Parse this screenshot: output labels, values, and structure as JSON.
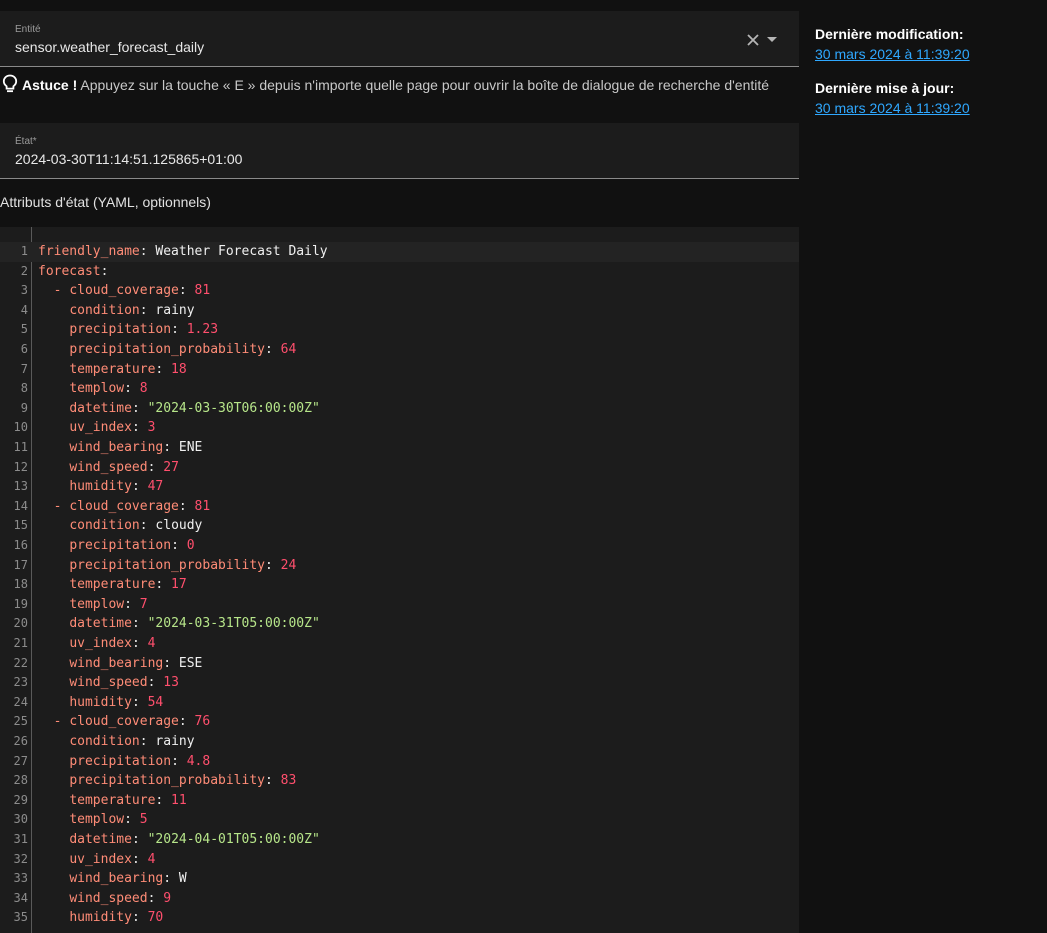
{
  "entity": {
    "label": "Entité",
    "value": "sensor.weather_forecast_daily"
  },
  "tip": {
    "bold": "Astuce !",
    "text": " Appuyez sur la touche « E » depuis n'importe quelle page pour ouvrir la boîte de dialogue de recherche d'entité"
  },
  "state": {
    "label": "État*",
    "value": "2024-03-30T11:14:51.125865+01:00"
  },
  "attributes_heading": "Attributs d'état (YAML, optionnels)",
  "sidebar": {
    "last_changed_label": "Dernière modification:",
    "last_changed_value": "30 mars 2024 à 11:39:20",
    "last_updated_label": "Dernière mise à jour:",
    "last_updated_value": "30 mars 2024 à 11:39:20"
  },
  "colors": {
    "key": "#ff8c77",
    "number": "#ff4f6d",
    "string": "#b7e68a",
    "link": "#2fa8ff"
  },
  "yaml_lines": [
    {
      "indent": "",
      "dash": false,
      "key": "friendly_name",
      "value": "Weather Forecast Daily",
      "type": "w"
    },
    {
      "indent": "",
      "dash": false,
      "key": "forecast",
      "value": "",
      "type": "w"
    },
    {
      "indent": "  ",
      "dash": true,
      "key": "cloud_coverage",
      "value": "81",
      "type": "n"
    },
    {
      "indent": "    ",
      "dash": false,
      "key": "condition",
      "value": "rainy",
      "type": "w"
    },
    {
      "indent": "    ",
      "dash": false,
      "key": "precipitation",
      "value": "1.23",
      "type": "n"
    },
    {
      "indent": "    ",
      "dash": false,
      "key": "precipitation_probability",
      "value": "64",
      "type": "n"
    },
    {
      "indent": "    ",
      "dash": false,
      "key": "temperature",
      "value": "18",
      "type": "n"
    },
    {
      "indent": "    ",
      "dash": false,
      "key": "templow",
      "value": "8",
      "type": "n"
    },
    {
      "indent": "    ",
      "dash": false,
      "key": "datetime",
      "value": "\"2024-03-30T06:00:00Z\"",
      "type": "s"
    },
    {
      "indent": "    ",
      "dash": false,
      "key": "uv_index",
      "value": "3",
      "type": "n"
    },
    {
      "indent": "    ",
      "dash": false,
      "key": "wind_bearing",
      "value": "ENE",
      "type": "w"
    },
    {
      "indent": "    ",
      "dash": false,
      "key": "wind_speed",
      "value": "27",
      "type": "n"
    },
    {
      "indent": "    ",
      "dash": false,
      "key": "humidity",
      "value": "47",
      "type": "n"
    },
    {
      "indent": "  ",
      "dash": true,
      "key": "cloud_coverage",
      "value": "81",
      "type": "n"
    },
    {
      "indent": "    ",
      "dash": false,
      "key": "condition",
      "value": "cloudy",
      "type": "w"
    },
    {
      "indent": "    ",
      "dash": false,
      "key": "precipitation",
      "value": "0",
      "type": "n"
    },
    {
      "indent": "    ",
      "dash": false,
      "key": "precipitation_probability",
      "value": "24",
      "type": "n"
    },
    {
      "indent": "    ",
      "dash": false,
      "key": "temperature",
      "value": "17",
      "type": "n"
    },
    {
      "indent": "    ",
      "dash": false,
      "key": "templow",
      "value": "7",
      "type": "n"
    },
    {
      "indent": "    ",
      "dash": false,
      "key": "datetime",
      "value": "\"2024-03-31T05:00:00Z\"",
      "type": "s"
    },
    {
      "indent": "    ",
      "dash": false,
      "key": "uv_index",
      "value": "4",
      "type": "n"
    },
    {
      "indent": "    ",
      "dash": false,
      "key": "wind_bearing",
      "value": "ESE",
      "type": "w"
    },
    {
      "indent": "    ",
      "dash": false,
      "key": "wind_speed",
      "value": "13",
      "type": "n"
    },
    {
      "indent": "    ",
      "dash": false,
      "key": "humidity",
      "value": "54",
      "type": "n"
    },
    {
      "indent": "  ",
      "dash": true,
      "key": "cloud_coverage",
      "value": "76",
      "type": "n"
    },
    {
      "indent": "    ",
      "dash": false,
      "key": "condition",
      "value": "rainy",
      "type": "w"
    },
    {
      "indent": "    ",
      "dash": false,
      "key": "precipitation",
      "value": "4.8",
      "type": "n"
    },
    {
      "indent": "    ",
      "dash": false,
      "key": "precipitation_probability",
      "value": "83",
      "type": "n"
    },
    {
      "indent": "    ",
      "dash": false,
      "key": "temperature",
      "value": "11",
      "type": "n"
    },
    {
      "indent": "    ",
      "dash": false,
      "key": "templow",
      "value": "5",
      "type": "n"
    },
    {
      "indent": "    ",
      "dash": false,
      "key": "datetime",
      "value": "\"2024-04-01T05:00:00Z\"",
      "type": "s"
    },
    {
      "indent": "    ",
      "dash": false,
      "key": "uv_index",
      "value": "4",
      "type": "n"
    },
    {
      "indent": "    ",
      "dash": false,
      "key": "wind_bearing",
      "value": "W",
      "type": "w"
    },
    {
      "indent": "    ",
      "dash": false,
      "key": "wind_speed",
      "value": "9",
      "type": "n"
    },
    {
      "indent": "    ",
      "dash": false,
      "key": "humidity",
      "value": "70",
      "type": "n"
    }
  ]
}
